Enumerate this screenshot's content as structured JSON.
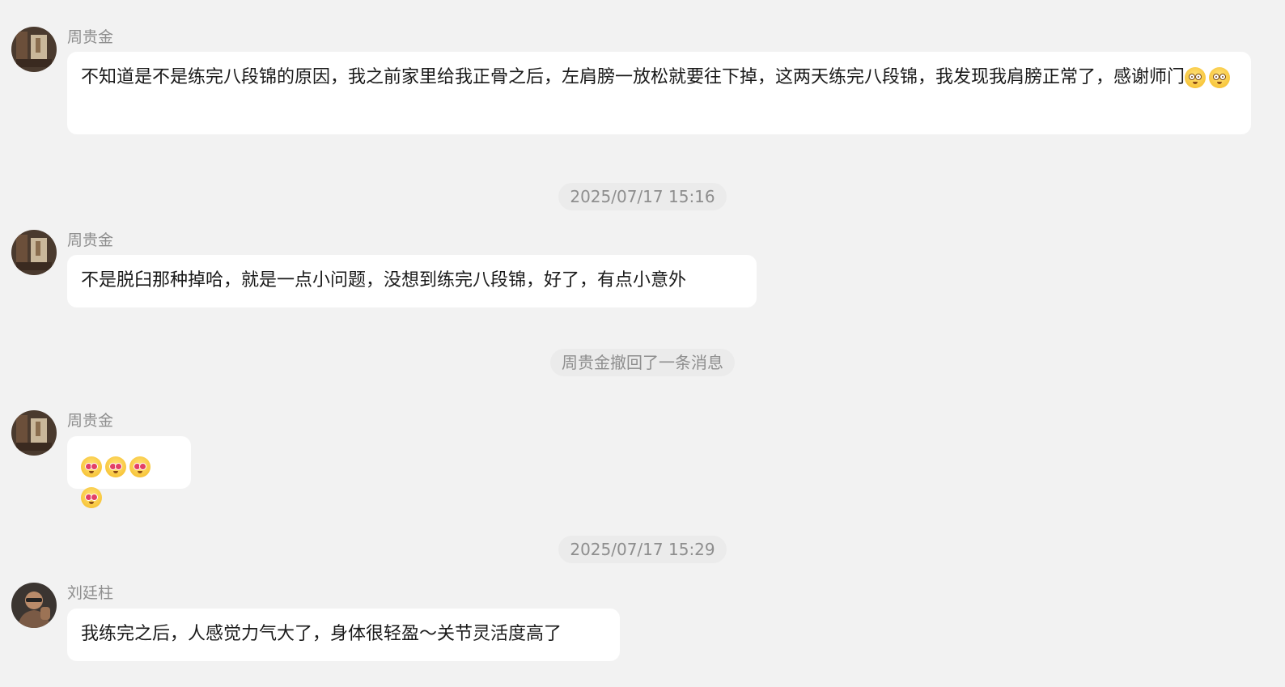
{
  "messages": [
    {
      "sender": "周贵金",
      "text": "不知道是不是练完八段锦的原因，我之前家里给我正骨之后，左肩膀一放松就要往下掉，这两天练完八段锦，我发现我肩膀正常了，感谢师门",
      "trailing_emojis": [
        "flushed-face-emoji",
        "flushed-face-emoji"
      ]
    },
    {
      "timestamp": "2025/07/17 15:16"
    },
    {
      "sender": "周贵金",
      "text": "不是脱臼那种掉哈，就是一点小问题，没想到练完八段锦，好了，有点小意外"
    },
    {
      "system_notice": "周贵金撤回了一条消息"
    },
    {
      "sender": "周贵金",
      "emojis": [
        "heart-eyes-emoji",
        "heart-eyes-emoji",
        "heart-eyes-emoji",
        "heart-eyes-emoji"
      ]
    },
    {
      "timestamp": "2025/07/17 15:29"
    },
    {
      "sender": "刘廷柱",
      "text": "我练完之后，人感觉力气大了，身体很轻盈～关节灵活度高了"
    }
  ],
  "colors": {
    "background": "#f2f2f2",
    "bubble": "#ffffff",
    "meta_text": "#8e8e8e",
    "pill": "#ebebeb"
  }
}
